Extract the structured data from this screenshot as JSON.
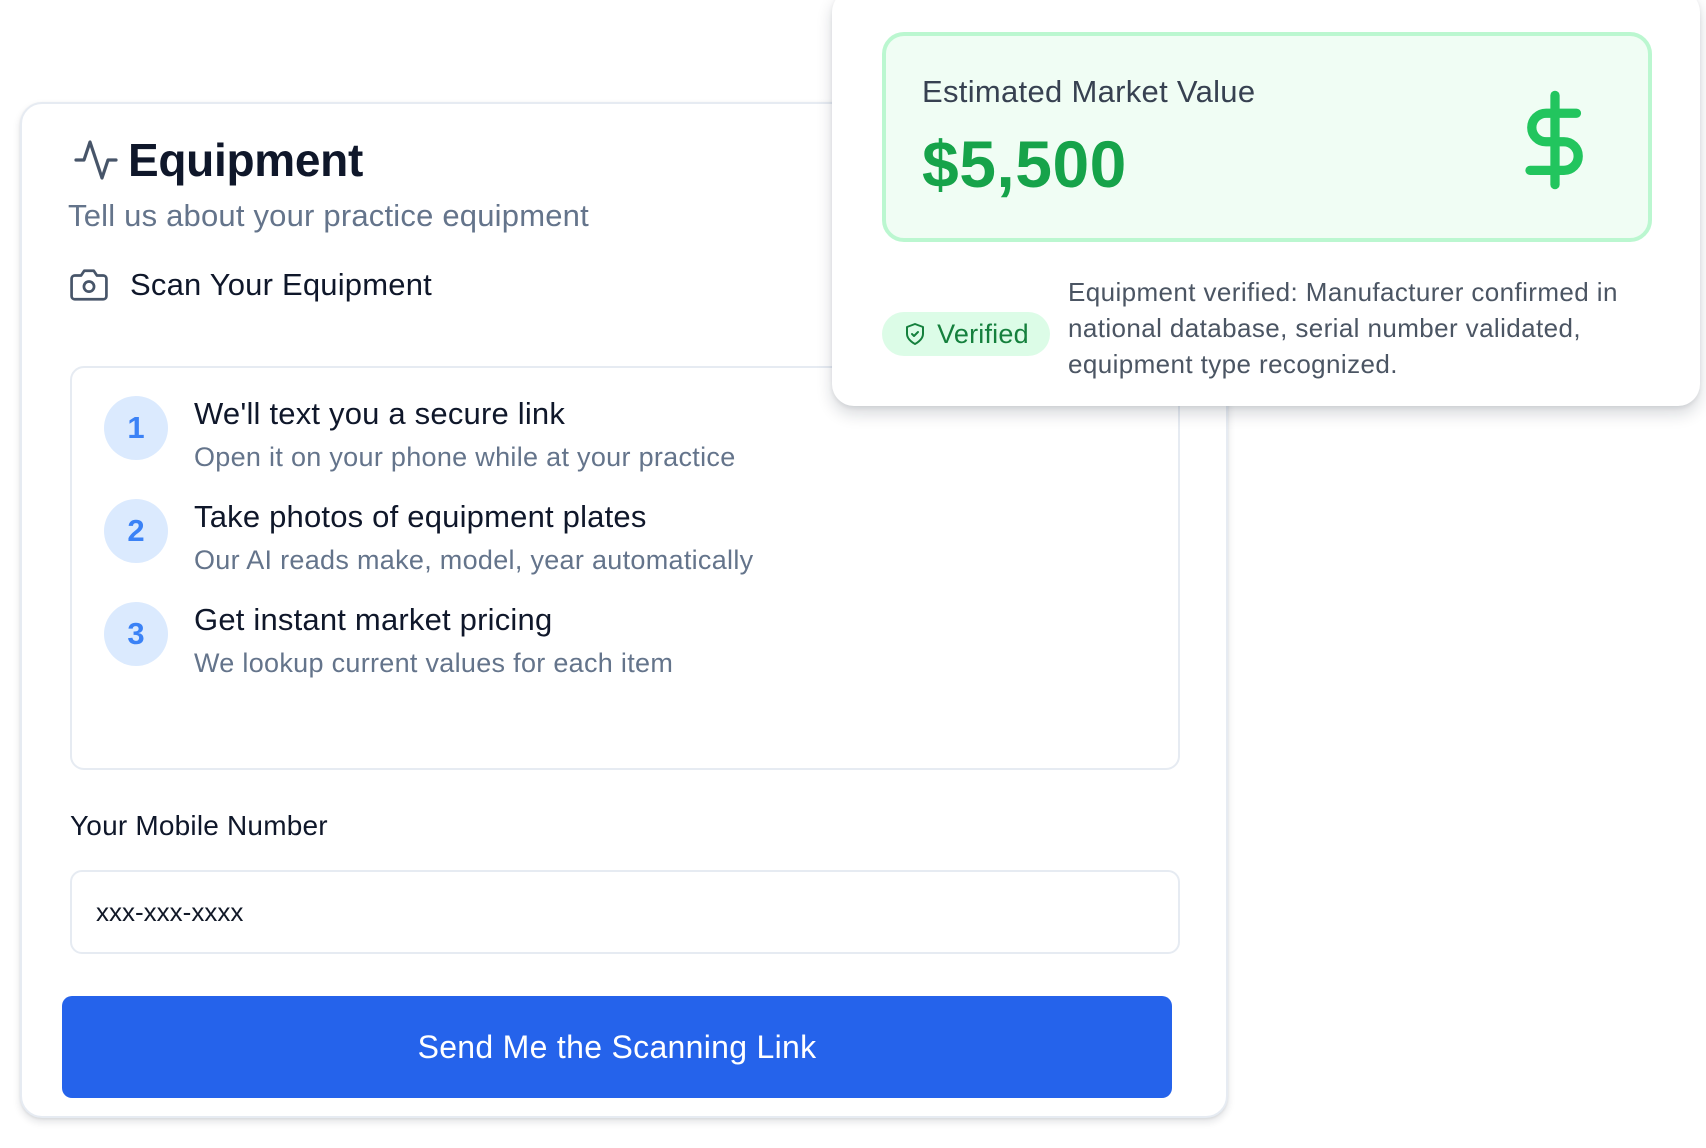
{
  "equipment": {
    "title": "Equipment",
    "subtitle": "Tell us about your practice equipment",
    "scan_title": "Scan Your Equipment",
    "steps": [
      {
        "number": "1",
        "title": "We'll text you a secure link",
        "description": "Open it on your phone while at your practice"
      },
      {
        "number": "2",
        "title": "Take photos of equipment plates",
        "description": "Our AI reads make, model, year automatically"
      },
      {
        "number": "3",
        "title": "Get instant market pricing",
        "description": "We lookup current values for each item"
      }
    ],
    "mobile_label": "Your Mobile Number",
    "mobile_placeholder": "xxx-xxx-xxxx",
    "mobile_value": "",
    "send_button_label": "Send Me the Scanning Link"
  },
  "valuation": {
    "label": "Estimated Market Value",
    "amount": "$5,500",
    "badge": "Verified",
    "note": "Equipment verified: Manufacturer confirmed in national database, serial number validated, equipment type recognized."
  },
  "icons": {
    "title_icon": "activity-icon",
    "scan_icon": "camera-icon",
    "value_icon": "dollar-icon",
    "badge_icon": "shield-check-icon"
  },
  "colors": {
    "primary": "#2563eb",
    "step_badge_bg": "#dbeafe",
    "step_badge_text": "#3b82f6",
    "value_green": "#16a34a",
    "value_box_bg": "#f0fdf4",
    "value_box_border": "#bbf7d0",
    "badge_bg": "#dcfce7",
    "badge_text": "#15803d",
    "muted_text": "#64748b"
  }
}
